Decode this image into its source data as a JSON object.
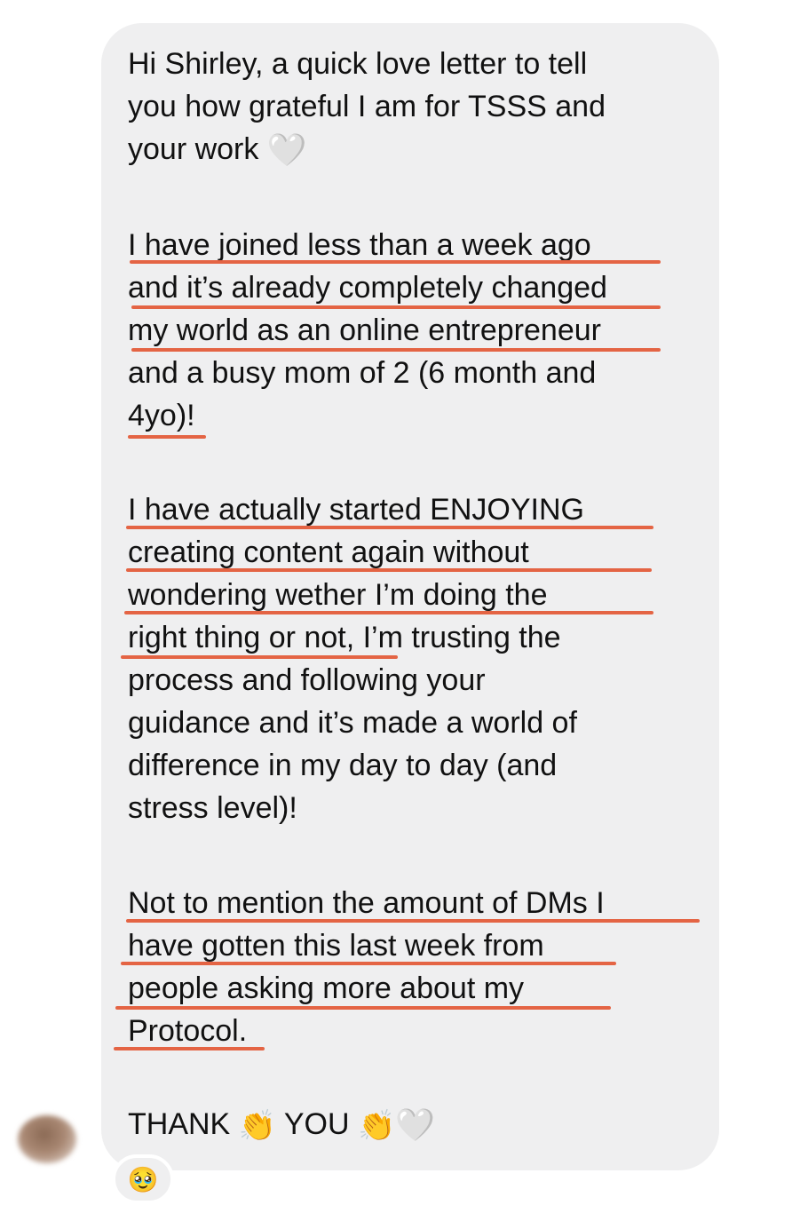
{
  "message": {
    "paragraph_1": [
      "Hi Shirley, a quick love letter to tell",
      "you how grateful I am for TSSS and",
      "your work"
    ],
    "paragraph_2": [
      "I have joined less than a week ago",
      "and it’s already completely changed",
      "my world as an online entrepreneur",
      "and a busy mom of 2 (6 month and",
      "4yo)!"
    ],
    "paragraph_3": [
      "I have actually started ENJOYING",
      "creating content again without",
      "wondering wether I’m doing the",
      "right thing or not, I’m trusting the",
      "process and following your",
      "guidance and it’s made a world of",
      "difference in my day to day (and",
      "stress level)!"
    ],
    "paragraph_4": [
      "Not to mention the amount of DMs I",
      "have gotten this last week from",
      "people asking more about my",
      "Protocol."
    ],
    "closing": {
      "word_1": "THANK",
      "word_2": "YOU"
    },
    "emoji": {
      "heart": "🤍",
      "clap": "👏",
      "reaction": "🥹"
    }
  },
  "colors": {
    "bubble": "#efeff0",
    "underline": "#e46444",
    "text": "#111111"
  },
  "icons": [
    "white-heart-icon",
    "clapping-hands-icon",
    "pleading-face-icon"
  ]
}
